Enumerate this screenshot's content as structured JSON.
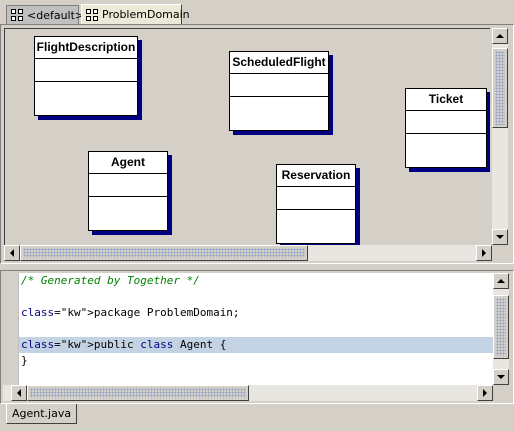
{
  "tabs": [
    {
      "label": "<default>",
      "icon": "diagram-icon",
      "active": false
    },
    {
      "label": "ProblemDomain",
      "icon": "diagram-icon",
      "active": true
    }
  ],
  "classes": [
    {
      "name": "FlightDescription"
    },
    {
      "name": "ScheduledFlight"
    },
    {
      "name": "Ticket"
    },
    {
      "name": "Agent"
    },
    {
      "name": "Reservation"
    }
  ],
  "editor": {
    "lines": [
      "/* Generated by Together */",
      "",
      "package ProblemDomain;",
      "",
      "public class Agent {",
      "}"
    ]
  },
  "file_tab": {
    "label": "Agent.java"
  },
  "colors": {
    "class_shadow": "#000080",
    "highlight_line": "#c4d3e3",
    "comment": "#008000",
    "keyword": "#000080"
  }
}
